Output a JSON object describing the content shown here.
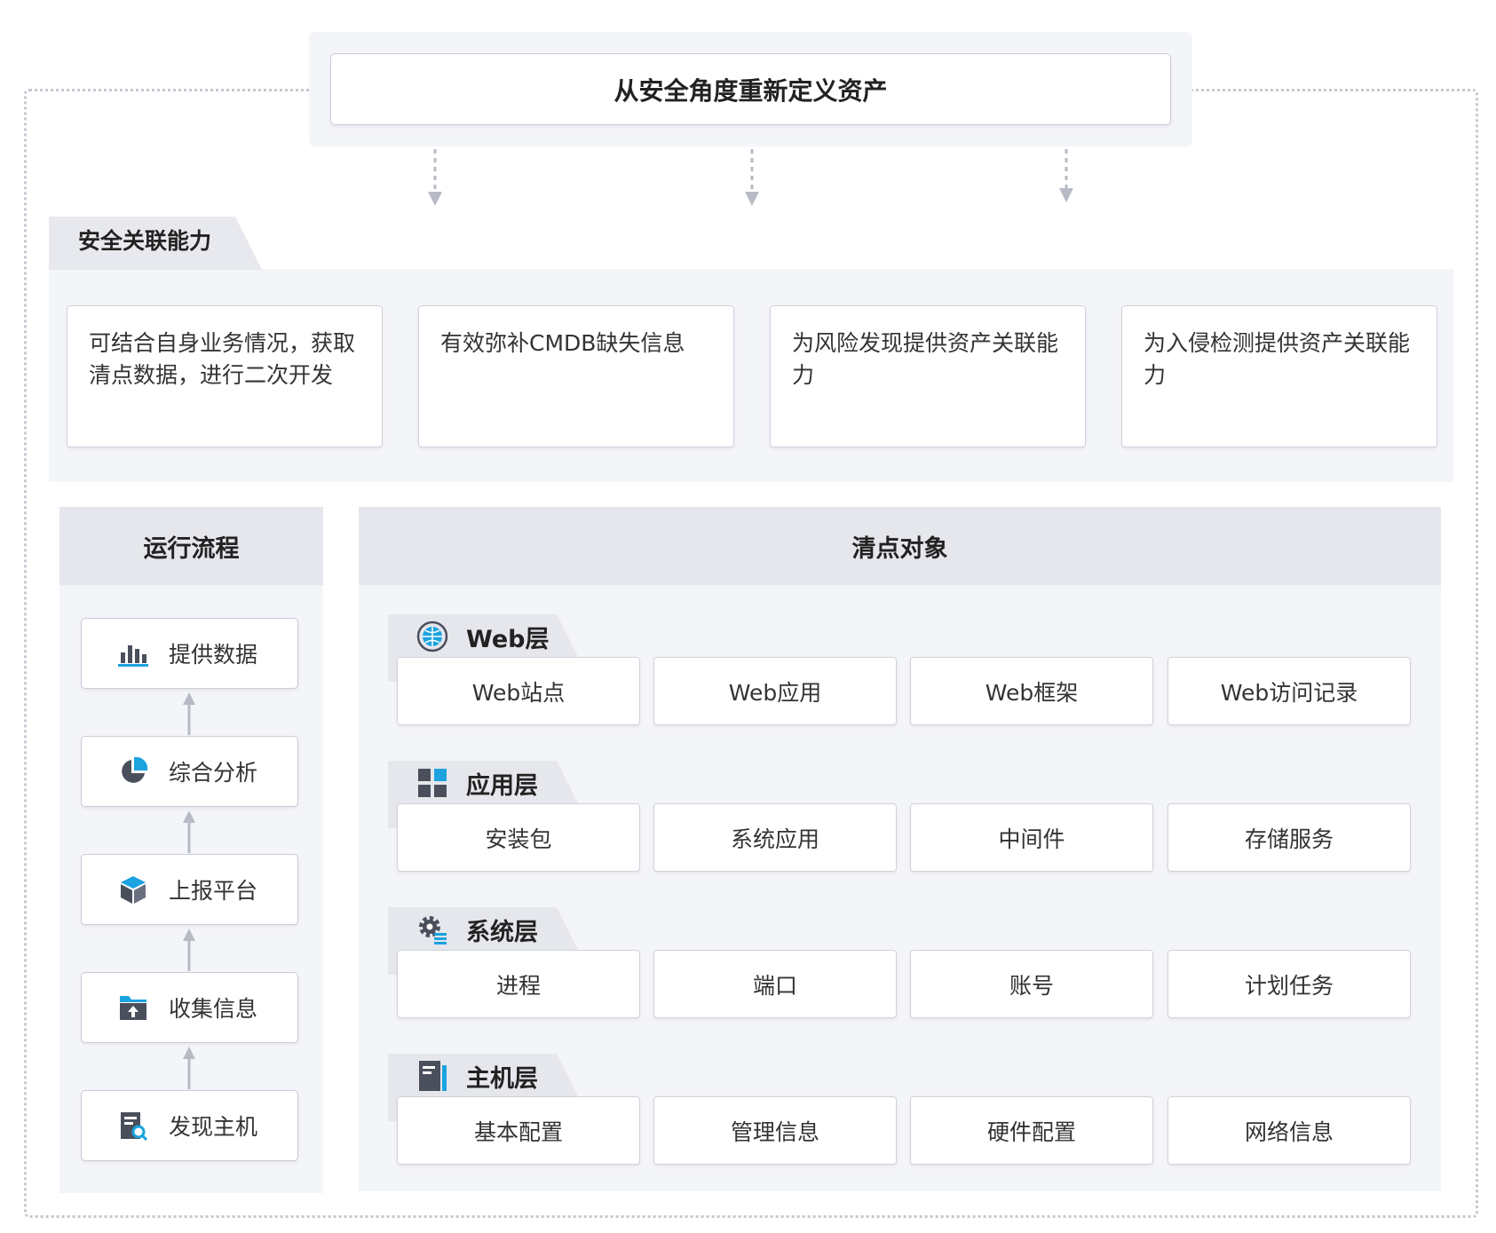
{
  "top": {
    "title": "从安全角度重新定义资产"
  },
  "capability": {
    "title": "安全关联能力",
    "cards": [
      "可结合自身业务情况，获取清点数据，进行二次开发",
      "有效弥补CMDB缺失信息",
      "为风险发现提供资产关联能力",
      "为入侵检测提供资产关联能力"
    ]
  },
  "flow": {
    "title": "运行流程",
    "steps": [
      {
        "label": "提供数据",
        "icon": "bar-chart-icon"
      },
      {
        "label": "综合分析",
        "icon": "pie-chart-icon"
      },
      {
        "label": "上报平台",
        "icon": "cube-icon"
      },
      {
        "label": "收集信息",
        "icon": "folder-upload-icon"
      },
      {
        "label": "发现主机",
        "icon": "host-search-icon"
      }
    ]
  },
  "objects": {
    "title": "清点对象",
    "layers": [
      {
        "name": "Web层",
        "icon": "globe-icon",
        "items": [
          "Web站点",
          "Web应用",
          "Web框架",
          "Web访问记录"
        ]
      },
      {
        "name": "应用层",
        "icon": "grid-icon",
        "items": [
          "安装包",
          "系统应用",
          "中间件",
          "存储服务"
        ]
      },
      {
        "name": "系统层",
        "icon": "gear-icon",
        "items": [
          "进程",
          "端口",
          "账号",
          "计划任务"
        ]
      },
      {
        "name": "主机层",
        "icon": "server-icon",
        "items": [
          "基本配置",
          "管理信息",
          "硬件配置",
          "网络信息"
        ]
      }
    ]
  },
  "colors": {
    "dark": "#4a4f5c",
    "accent": "#1ba3e0",
    "panel": "#f4f5f9",
    "header": "#e6e7ec"
  }
}
